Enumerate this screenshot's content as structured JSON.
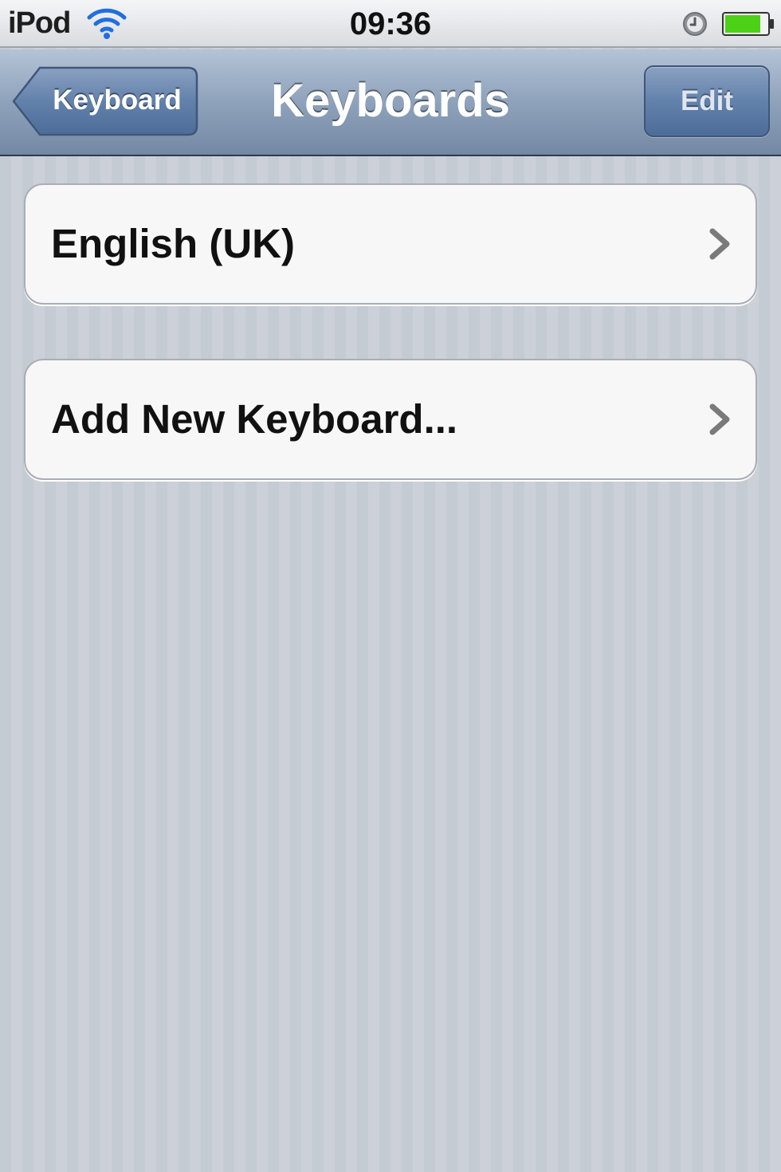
{
  "status_bar": {
    "carrier": "iPod",
    "time": "09:36",
    "icons": [
      "wifi-icon",
      "alarm-clock-icon",
      "battery-icon"
    ],
    "battery_level": 0.85
  },
  "nav_bar": {
    "back_label": "Keyboard",
    "title": "Keyboards",
    "edit_label": "Edit"
  },
  "cells": [
    {
      "label": "English (UK)",
      "icon": "chevron-right-icon"
    },
    {
      "label": "Add New Keyboard...",
      "icon": "chevron-right-icon"
    }
  ],
  "colors": {
    "nav_bar": "#8ea2bb",
    "cell_background": "#f7f7f7",
    "battery_green": "#4cd117",
    "wifi_blue": "#1f6fe0"
  }
}
